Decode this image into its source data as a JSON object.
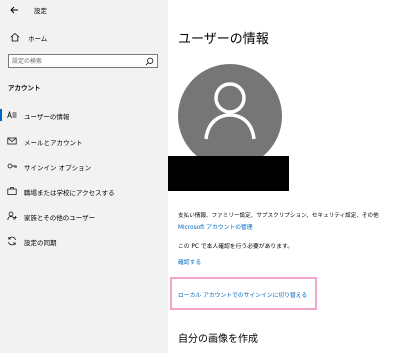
{
  "app": {
    "title": "設定",
    "back_icon": "back-arrow-icon"
  },
  "sidebar": {
    "home_label": "ホーム",
    "search_placeholder": "設定の検索",
    "section_label": "アカウント",
    "items": [
      {
        "label": "ユーザーの情報",
        "icon": "user-info-icon",
        "selected": true
      },
      {
        "label": "メールとアカウント",
        "icon": "mail-icon",
        "selected": false
      },
      {
        "label": "サインイン オプション",
        "icon": "key-icon",
        "selected": false
      },
      {
        "label": "職場または学校にアクセスする",
        "icon": "briefcase-icon",
        "selected": false
      },
      {
        "label": "家族とその他のユーザー",
        "icon": "person-add-icon",
        "selected": false
      },
      {
        "label": "設定の同期",
        "icon": "sync-icon",
        "selected": false
      }
    ]
  },
  "main": {
    "title": "ユーザーの情報",
    "info_text": "支払い情報、ファミリー設定、サブスクリプション、セキュリティ設定、その他",
    "ms_account_link": "Microsoft アカウントの管理",
    "verify_text": "この PC で本人確認を行う必要があります。",
    "verify_link": "確認する",
    "local_signin_link": "ローカル アカウントでのサインインに切り替える",
    "picture_section_title": "自分の画像を作成"
  },
  "colors": {
    "sidebar_bg": "#f2f2f2",
    "link": "#0067c0",
    "avatar_bg": "#767676",
    "highlight_border": "#f3a6c9"
  }
}
